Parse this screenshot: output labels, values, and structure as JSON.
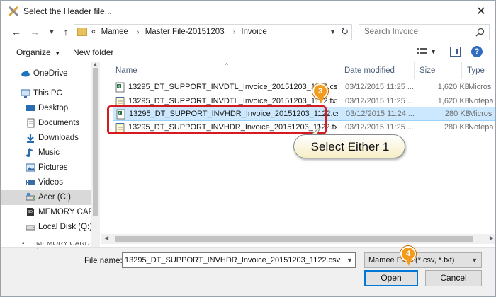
{
  "window": {
    "title": "Select the Header file..."
  },
  "address": {
    "crumb_prefix": "«",
    "crumbs": [
      "Mamee",
      "Master File-20151203",
      "Invoice"
    ],
    "separator": "›",
    "search_placeholder": "Search Invoice"
  },
  "toolbar": {
    "organize": "Organize",
    "new_folder": "New folder"
  },
  "nav": {
    "items": [
      {
        "label": "OneDrive",
        "icon": "cloud-icon"
      },
      {
        "label": "This PC",
        "icon": "computer-icon"
      },
      {
        "label": "Desktop",
        "icon": "desktop-icon"
      },
      {
        "label": "Documents",
        "icon": "documents-icon"
      },
      {
        "label": "Downloads",
        "icon": "downloads-icon"
      },
      {
        "label": "Music",
        "icon": "music-icon"
      },
      {
        "label": "Pictures",
        "icon": "pictures-icon"
      },
      {
        "label": "Videos",
        "icon": "videos-icon"
      },
      {
        "label": "Acer (C:)",
        "icon": "drive-icon",
        "selected": true
      },
      {
        "label": "MEMORY CARD",
        "icon": "sd-card-icon"
      },
      {
        "label": "Local Disk (Q:)",
        "icon": "disk-icon"
      }
    ],
    "bottom_partial": "MEMORY CARD (..."
  },
  "columns": {
    "name": "Name",
    "date": "Date modified",
    "size": "Size",
    "type": "Type"
  },
  "files": [
    {
      "name": "13295_DT_SUPPORT_INVDTL_Invoice_20151203_1122.csv",
      "date": "03/12/2015 11:25 ...",
      "size": "1,620 KB",
      "type": "Micros",
      "kind": "csv",
      "selected": false
    },
    {
      "name": "13295_DT_SUPPORT_INVDTL_Invoice_20151203_1122.txt",
      "date": "03/12/2015 11:25 ...",
      "size": "1,620 KB",
      "type": "Notepa",
      "kind": "txt",
      "selected": false
    },
    {
      "name": "13295_DT_SUPPORT_INVHDR_Invoice_20151203_1122.csv",
      "date": "03/12/2015 11:24 ...",
      "size": "280 KB",
      "type": "Micros",
      "kind": "csv",
      "selected": true
    },
    {
      "name": "13295_DT_SUPPORT_INVHDR_Invoice_20151203_1122.txt",
      "date": "03/12/2015 11:25 ...",
      "size": "280 KB",
      "type": "Notepa",
      "kind": "txt",
      "selected": false
    }
  ],
  "callouts": {
    "badge3": "3",
    "badge4": "4",
    "bubble": "Select Either 1"
  },
  "footer": {
    "file_name_label": "File name:",
    "file_name_value": "13295_DT_SUPPORT_INVHDR_Invoice_20151203_1122.csv",
    "filter_value": "Mamee Files (*.csv, *.txt)",
    "open_label": "Open",
    "cancel_label": "Cancel"
  },
  "colors": {
    "accent": "#0078d7",
    "highlight": "#d71920",
    "badge": "#f39b1d",
    "selection": "#cce8ff"
  }
}
